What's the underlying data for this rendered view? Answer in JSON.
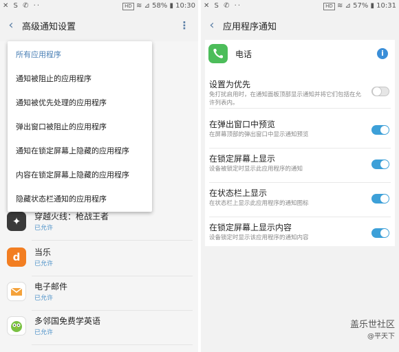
{
  "left": {
    "status": {
      "left_icons": "✕ S ✆ ··",
      "hd": "HD",
      "right": "≋ ⊿ 58% ▮ 10:30"
    },
    "title": "高级通知设置",
    "dropdown": [
      "所有应用程序",
      "通知被阻止的应用程序",
      "通知被优先处理的应用程序",
      "弹出窗口被阻止的应用程序",
      "通知在锁定屏幕上隐藏的应用程序",
      "内容在锁定屏幕上隐藏的应用程序",
      "隐藏状态栏通知的应用程序"
    ],
    "apps": [
      {
        "name": "穿越火线：枪战王者",
        "status": "已允许",
        "icon_color": "#3a3a3a",
        "icon": "warrior-icon"
      },
      {
        "name": "当乐",
        "status": "已允许",
        "icon_color": "#f27e22",
        "icon": "dangle-icon"
      },
      {
        "name": "电子邮件",
        "status": "已允许",
        "icon_color": "#ffffff",
        "icon": "envelope-icon"
      },
      {
        "name": "多邻国免费学英语",
        "status": "已允许",
        "icon_color": "#ffffff",
        "icon": "duolingo-owl-icon"
      }
    ]
  },
  "right": {
    "status": {
      "left_icons": "✕ S ✆ ··",
      "hd": "HD",
      "right": "≋ ⊿ 57% ▮ 10:31"
    },
    "title": "应用程序通知",
    "app_name": "电话",
    "settings": [
      {
        "title": "设置为优先",
        "desc": "免打扰启用时，在通知面板顶部显示通知并将它们包括在允许列表内。",
        "on": false
      },
      {
        "title": "在弹出窗口中预览",
        "desc": "在屏幕顶部的弹出窗口中显示通知预览",
        "on": true
      },
      {
        "title": "在锁定屏幕上显示",
        "desc": "设备被锁定时显示此应用程序的通知",
        "on": true
      },
      {
        "title": "在状态栏上显示",
        "desc": "在状态栏上显示此应用程序的通知图标",
        "on": true
      },
      {
        "title": "在锁定屏幕上显示内容",
        "desc": "设备锁定时显示该应用程序的通知内容",
        "on": true
      }
    ],
    "watermark": {
      "line1": "盖乐世社区",
      "line2": "@平天下"
    }
  }
}
